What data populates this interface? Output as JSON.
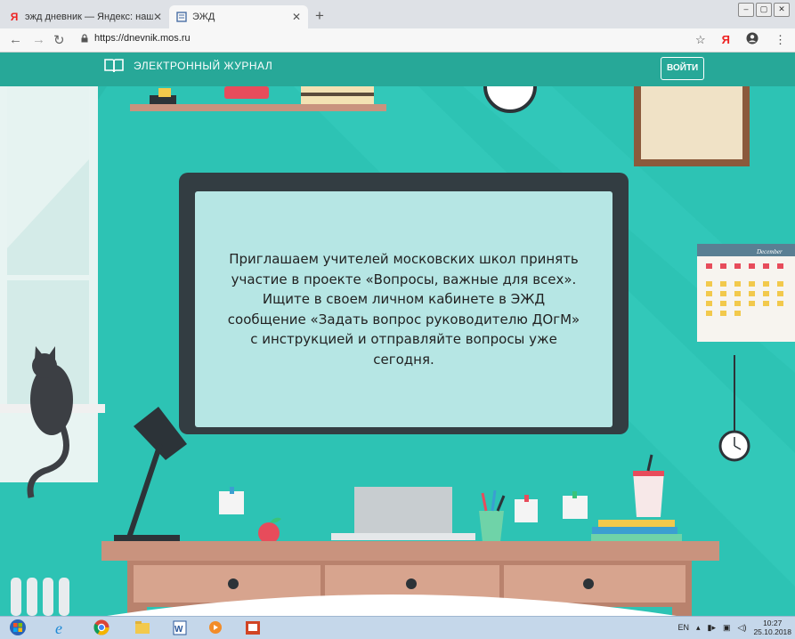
{
  "browser": {
    "tabs": [
      {
        "title": "эжд дневник — Яндекс: нашло",
        "active": false,
        "favicon": "yandex-icon"
      },
      {
        "title": "ЭЖД",
        "active": true,
        "favicon": "page-icon"
      }
    ],
    "new_tab": "+",
    "address": "https://dnevnik.mos.ru",
    "yandex_letter": "Я"
  },
  "site": {
    "logo_text": "ЭЛЕКТРОННЫЙ ЖУРНАЛ",
    "login_label": "ВОЙТИ",
    "message": "Приглашаем учителей московских школ принять участие в проекте «Вопросы, важные для всех». Ищите в своем личном кабинете в ЭЖД сообщение «Задать вопрос руководителю ДОгМ» с инструкцией и отправляйте вопросы уже сегодня.",
    "calendar_month": "December",
    "colors": {
      "header": "#27a898",
      "background": "#2dc3b4",
      "screen": "#b6e6e4"
    }
  },
  "taskbar": {
    "lang": "EN",
    "time": "10:27",
    "date": "25.10.2018"
  }
}
